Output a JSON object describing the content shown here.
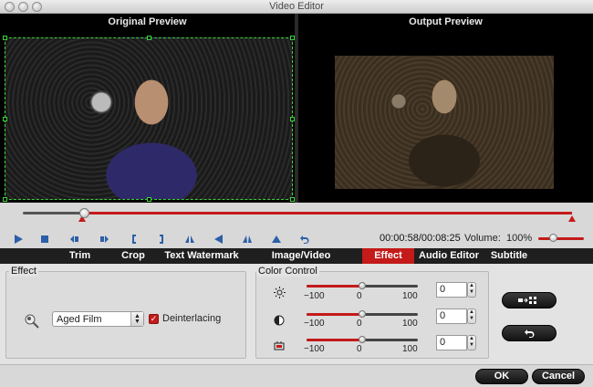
{
  "window": {
    "title": "Video Editor"
  },
  "preview": {
    "original_label": "Original Preview",
    "output_label": "Output Preview"
  },
  "playback": {
    "timecode": "00:00:58/00:08:25",
    "volume_label": "Volume:",
    "volume_value": "100%",
    "progress_fraction": 0.115
  },
  "tabs": [
    {
      "label": "Trim",
      "active": false
    },
    {
      "label": "Crop",
      "active": false
    },
    {
      "label": "Text Watermark",
      "active": false
    },
    {
      "label": "Image/Video Watermark",
      "active": false
    },
    {
      "label": "Effect",
      "active": true
    },
    {
      "label": "Audio Editor",
      "active": false
    },
    {
      "label": "Subtitle",
      "active": false
    }
  ],
  "effect": {
    "group_title": "Effect",
    "selected_effect": "Aged Film",
    "deinterlacing_label": "Deinterlacing",
    "deinterlacing_checked": true
  },
  "color_control": {
    "group_title": "Color Control",
    "controls": [
      {
        "icon": "brightness-icon",
        "min": "−100",
        "mid": "0",
        "max": "100",
        "value": "0"
      },
      {
        "icon": "contrast-icon",
        "min": "−100",
        "mid": "0",
        "max": "100",
        "value": "0"
      },
      {
        "icon": "saturation-icon",
        "min": "−100",
        "mid": "0",
        "max": "100",
        "value": "0"
      }
    ]
  },
  "footer": {
    "ok_label": "OK",
    "cancel_label": "Cancel"
  },
  "colors": {
    "accent": "#c41a1a",
    "crop_border": "#3bd43b"
  }
}
